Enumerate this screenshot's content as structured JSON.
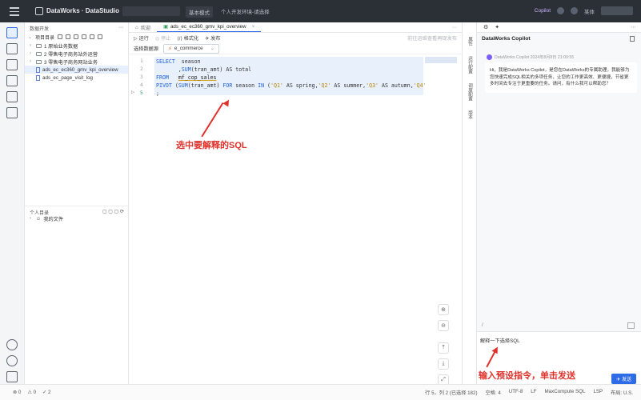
{
  "topbar": {
    "app_title": "DataWorks · DataStudio",
    "env_label": "基本模式",
    "workspace": "个人开发环境-请选择",
    "copilot": "Copilot",
    "user": "某体",
    "notif_badge": "1"
  },
  "explorer": {
    "title": "数据开发",
    "section": "项目目录",
    "tree": [
      {
        "label": "1 原始业务数据",
        "type": "folder"
      },
      {
        "label": "2 零售电子商务站外运营",
        "type": "folder"
      },
      {
        "label": "3 零售电子商务网站业务",
        "type": "folder"
      },
      {
        "label": "ads_ec_ec360_gmv_kpi_overview",
        "type": "file"
      },
      {
        "label": "ads_ec_page_visit_log",
        "type": "file"
      }
    ],
    "personal_title": "个人目录",
    "personal_item": "我的文件"
  },
  "editor": {
    "tabs": [
      {
        "label": "欢迎"
      },
      {
        "label": "ads_ec_ec360_gmv_kpi_overview"
      }
    ],
    "toolbar": {
      "run": "运行",
      "stop": "停止",
      "format": "格式化",
      "publish": "发布",
      "hint": "前往运维查看再现发布"
    },
    "datasource_label": "选择数据源",
    "datasource_value": "e_commerce",
    "code_lines": {
      "l1_kw": "SELECT",
      "l1_rest": "  season",
      "l2_pre": "       ,",
      "l2_fn": "SUM",
      "l2_rest": "(tran_amt) AS total",
      "l3_kw": "FROM",
      "l3_tbl": "mf_cop_sales",
      "l4_kw": "PIVOT",
      "l4_a": " (",
      "l4_fn": "SUM",
      "l4_b": "(tran_amt) ",
      "l4_kw2": "FOR",
      "l4_c": " season ",
      "l4_kw3": "IN",
      "l4_d": " (",
      "l4_s1": "'Q1'",
      "l4_e": " AS spring,",
      "l4_s2": "'Q2'",
      "l4_f": " AS summer,",
      "l4_s3": "'Q3'",
      "l4_g": " AS autumn,",
      "l4_s4": "'Q4'",
      "l5": ";"
    },
    "line_numbers": [
      "1",
      "2",
      "3",
      "4",
      "5"
    ]
  },
  "annotations": {
    "select_sql": "选中要解释的SQL",
    "send_hint": "输入预设指令，单击发送"
  },
  "side_tabs": [
    "属性",
    "运行配置",
    "调度配置",
    "版本"
  ],
  "copilot": {
    "title": "DataWorks Copilot",
    "meta": "DataWorks Copilot 2024年8月8日 21:09:55",
    "message": "Hi，我是DataWorks Copilot，是您在DataWorks的专属助理。我能够为您快速完成SQL相关的多项任务，让您的工作更高效、更便捷，节省更多时间去专注于更重要的任务。请问，有什么我可以帮助您？",
    "input_value": "解释一下选择SQL",
    "send": "发送",
    "slash": "/"
  },
  "status": {
    "errors": "0",
    "warnings": "0",
    "info": "2",
    "position": "行 5，列 2 (已选择 182)",
    "spaces": "空格: 4",
    "encoding": "UTF-8",
    "eol": "LF",
    "lang": "MaxCompute SQL",
    "lsp": "LSP",
    "region": "布局: U.S."
  }
}
